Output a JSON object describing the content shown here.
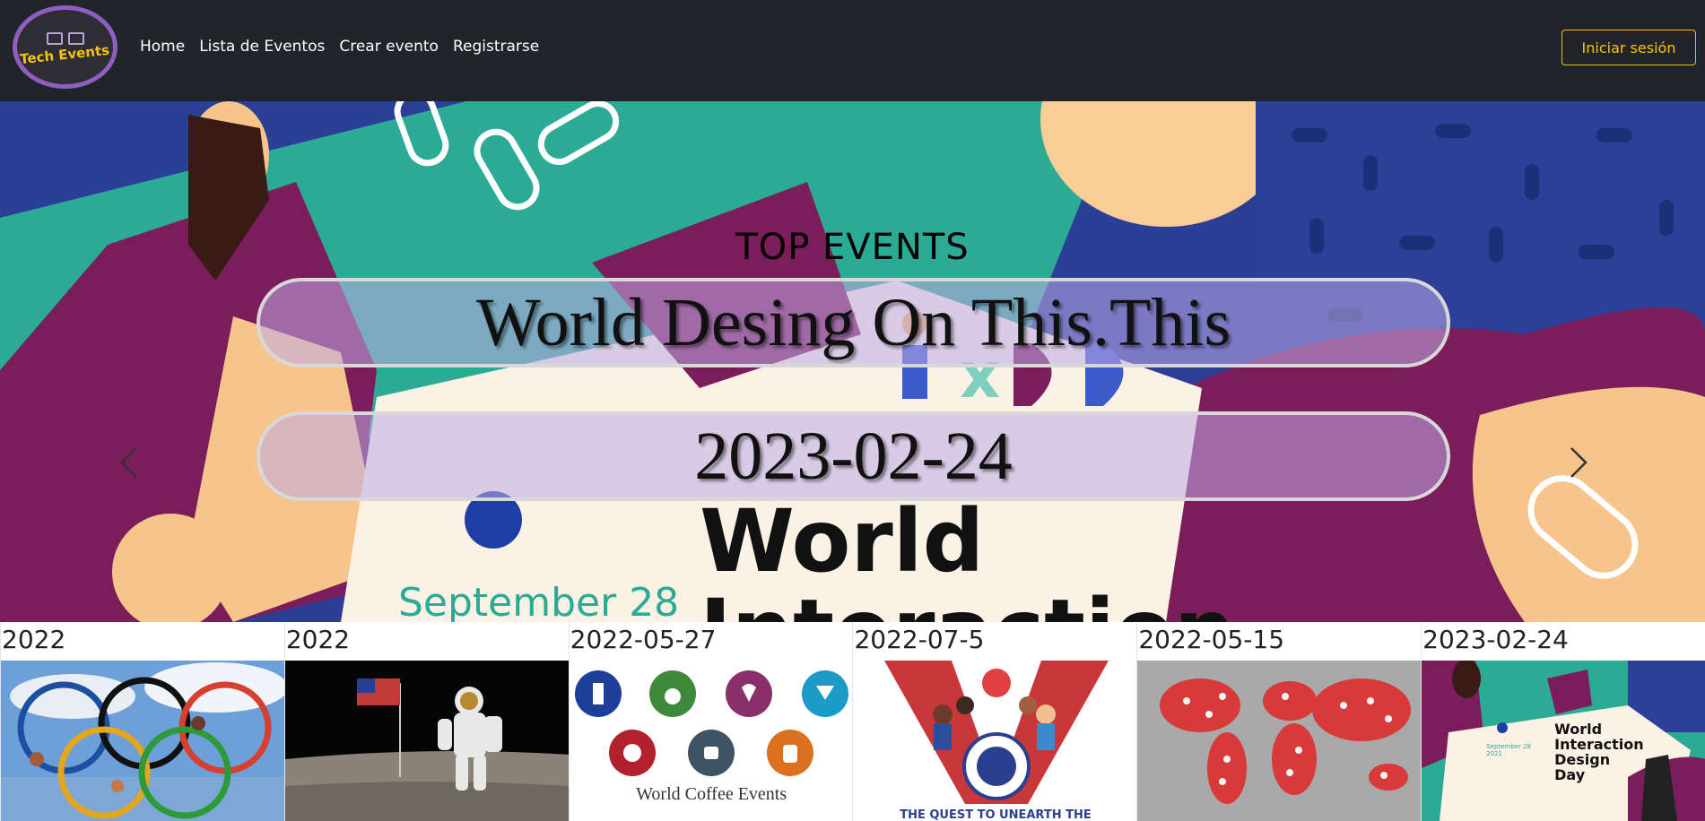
{
  "navbar": {
    "logo_text": "Tech Events",
    "links": [
      "Home",
      "Lista de Eventos",
      "Crear evento",
      "Registrarse"
    ],
    "login_label": "Iniciar sesión"
  },
  "hero": {
    "section_title": "TOP EVENTS",
    "event_name": "World Desing On This.This",
    "event_date": "2023-02-24",
    "prev_icon": "chevron-left-icon",
    "next_icon": "chevron-right-icon",
    "image_text": {
      "date": "September 28",
      "line1": "World",
      "line2": "Interaction"
    }
  },
  "cards": [
    {
      "date": "2022",
      "image": "olympic-rings"
    },
    {
      "date": "2022",
      "image": "astronaut-moon"
    },
    {
      "date": "2022-05-27",
      "image": "world-coffee-events",
      "caption": "World Coffee Events"
    },
    {
      "date": "2022-07-5",
      "image": "world-school-games",
      "caption": "THE QUEST TO UNEARTH THE"
    },
    {
      "date": "2022-05-15",
      "image": "world-map-molecules"
    },
    {
      "date": "2023-02-24",
      "image": "world-interaction-design-day",
      "caption": "World Interaction Design Day",
      "subcaption": "September 28 2021"
    }
  ],
  "colors": {
    "navbar_bg": "#212529",
    "login_accent": "#ffc107",
    "logo_ring": "#8e5fc0"
  }
}
